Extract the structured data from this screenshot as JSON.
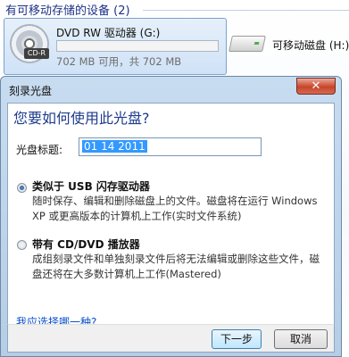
{
  "explorer": {
    "section_header": "有可移动存储的设备 (2)",
    "dvd_drive": {
      "name": "DVD RW 驱动器 (G:)",
      "disc_label": "CD-R",
      "space": "702 MB 可用，共 702 MB",
      "fill": 0.0
    },
    "removable_disk": {
      "name": "可移动磁盘 (H:)"
    }
  },
  "dialog": {
    "title": "刻录光盘",
    "close_glyph": "✕",
    "heading": "您要如何使用此光盘?",
    "disc_title_label": "光盘标题:",
    "disc_title_value": "01 14 2011",
    "options": [
      {
        "title": "类似于 USB 闪存驱动器",
        "description": "随时保存、编辑和删除磁盘上的文件。磁盘将在运行 Windows XP 或更高版本的计算机上工作(实时文件系统)",
        "checked": true
      },
      {
        "title": "带有 CD/DVD 播放器",
        "description": "成组刻录文件和单独刻录文件后将无法编辑或删除这些文件，磁盘还将在大多数计算机上工作(Mastered)",
        "checked": false
      }
    ],
    "help_link": "我应选择哪一种?",
    "buttons": {
      "next": "下一步",
      "cancel": "取消"
    }
  }
}
